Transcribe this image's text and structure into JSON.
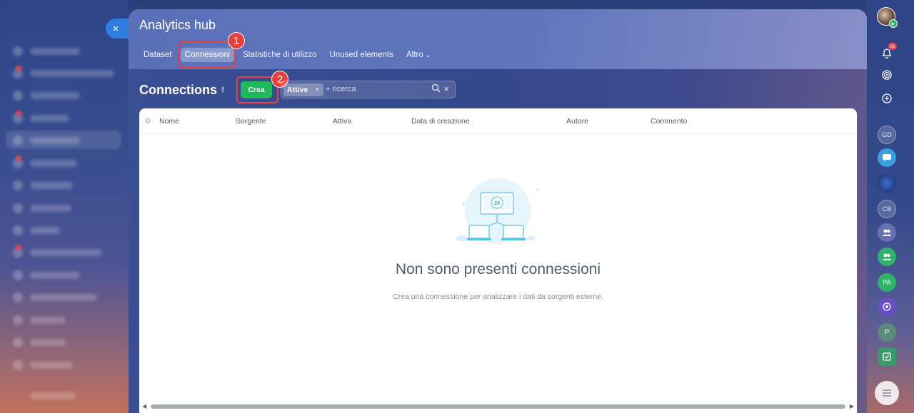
{
  "window": {
    "title": "Analytics hub",
    "close_glyph": "×"
  },
  "tabs": [
    {
      "label": "Dataset"
    },
    {
      "label": "Connessioni",
      "active": true
    },
    {
      "label": "Statistiche di utilizzo"
    },
    {
      "label": "Unused elements"
    },
    {
      "label": "Altro"
    }
  ],
  "page": {
    "heading": "Connections",
    "pin_icon": "pin-icon",
    "create_label": "Crea"
  },
  "filter": {
    "chip_label": "Attive",
    "chip_remove": "×",
    "placeholder": "+ ricerca",
    "search_glyph": "⌕",
    "clear_glyph": "×"
  },
  "callouts": [
    {
      "number": "1",
      "color": "#e8403a"
    },
    {
      "number": "2",
      "color": "#e8403a"
    }
  ],
  "table": {
    "columns": [
      "Nome",
      "Sorgente",
      "Attiva",
      "Data di creazione",
      "Autore",
      "Commento"
    ]
  },
  "empty_state": {
    "title": "Non sono presenti connessioni",
    "description": "Crea una connessione per analizzare i dati da sorgenti esterne.",
    "illustration_text": "24"
  },
  "right_sidebar": {
    "notifications_count": "31",
    "items": [
      {
        "icon": "bell-icon"
      },
      {
        "icon": "spiral-icon"
      },
      {
        "icon": "chat-icon"
      },
      {
        "label": "GD"
      },
      {
        "icon": "message-icon"
      },
      {
        "icon": "group-avatar-icon"
      },
      {
        "label": "CB"
      },
      {
        "icon": "users-icon"
      },
      {
        "icon": "users-icon"
      },
      {
        "label": "PA"
      },
      {
        "icon": "target-icon"
      },
      {
        "label": "P"
      },
      {
        "icon": "checkbox-icon"
      }
    ]
  },
  "colors": {
    "accent_blue": "#2f7de1",
    "create_green": "#1fb85a",
    "callout_red": "#e8403a"
  }
}
